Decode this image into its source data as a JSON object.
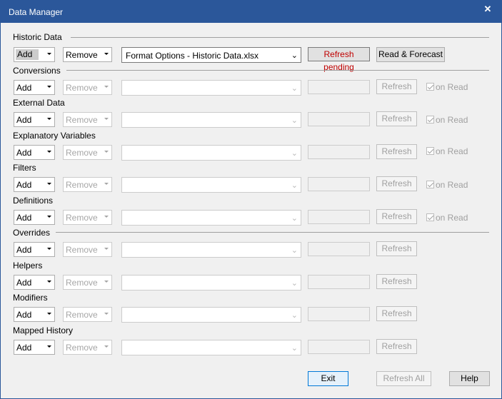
{
  "window": {
    "title": "Data Manager",
    "close_glyph": "✕"
  },
  "sections": {
    "historic": "Historic Data",
    "conversions": "Conversions",
    "overrides": "Overrides"
  },
  "historic_row": {
    "add": "Add",
    "remove": "Remove",
    "file": "Format Options - Historic Data.xlsx",
    "status": "Refresh pending",
    "action": "Read & Forecast"
  },
  "rows": [
    {
      "label": "",
      "add": "Add",
      "remove": "Remove",
      "file": "",
      "action": "Refresh",
      "check": "on Read"
    },
    {
      "label": "External Data",
      "add": "Add",
      "remove": "Remove",
      "file": "",
      "action": "Refresh",
      "check": "on Read"
    },
    {
      "label": "Explanatory Variables",
      "add": "Add",
      "remove": "Remove",
      "file": "",
      "action": "Refresh",
      "check": "on Read"
    },
    {
      "label": "Filters",
      "add": "Add",
      "remove": "Remove",
      "file": "",
      "action": "Refresh",
      "check": "on Read"
    },
    {
      "label": "Definitions",
      "add": "Add",
      "remove": "Remove",
      "file": "",
      "action": "Refresh",
      "check": "on Read"
    },
    {
      "label": "",
      "add": "Add",
      "remove": "Remove",
      "file": "",
      "action": "Refresh",
      "check": ""
    },
    {
      "label": "Helpers",
      "add": "Add",
      "remove": "Remove",
      "file": "",
      "action": "Refresh",
      "check": ""
    },
    {
      "label": "Modifiers",
      "add": "Add",
      "remove": "Remove",
      "file": "",
      "action": "Refresh",
      "check": ""
    },
    {
      "label": "Mapped History",
      "add": "Add",
      "remove": "Remove",
      "file": "",
      "action": "Refresh",
      "check": ""
    }
  ],
  "footer": {
    "exit": "Exit",
    "refresh_all": "Refresh All",
    "help": "Help"
  },
  "colors": {
    "titlebar": "#2b579a",
    "pending_text": "#c00000",
    "focus": "#0078d7"
  }
}
